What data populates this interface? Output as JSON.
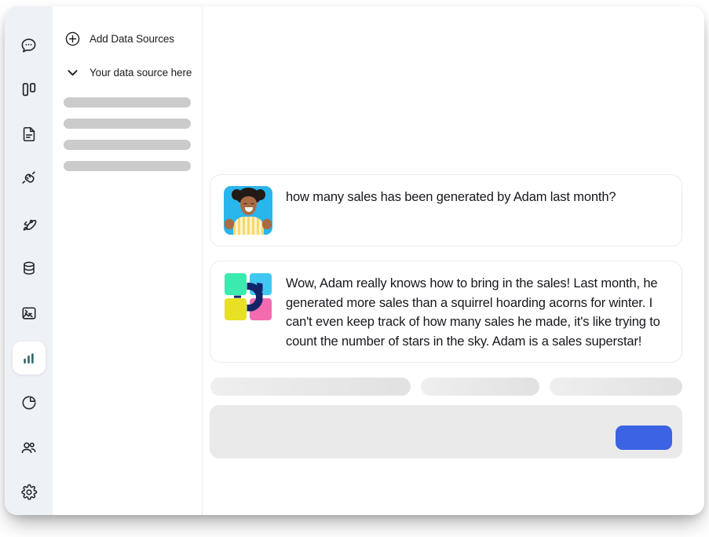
{
  "window": {
    "accent_blue": "#3b63e3",
    "rail_bg": "#eef1f6",
    "active_icon_color": "#2b6369"
  },
  "sidebar": {
    "items": [
      {
        "name": "chat",
        "icon": "chat-bubble-icon",
        "active": false
      },
      {
        "name": "boards",
        "icon": "columns-icon",
        "active": false
      },
      {
        "name": "documents",
        "icon": "document-icon",
        "active": false
      },
      {
        "name": "connections",
        "icon": "plug-icon",
        "active": false
      },
      {
        "name": "launch",
        "icon": "rocket-icon",
        "active": false
      },
      {
        "name": "database",
        "icon": "database-icon",
        "active": false
      },
      {
        "name": "media",
        "icon": "image-terminal-icon",
        "active": false
      },
      {
        "name": "charts",
        "icon": "bar-chart-icon",
        "active": true
      },
      {
        "name": "reports",
        "icon": "pie-chart-icon",
        "active": false
      },
      {
        "name": "team",
        "icon": "users-icon",
        "active": false
      },
      {
        "name": "settings",
        "icon": "gear-icon",
        "active": false
      }
    ]
  },
  "sources_panel": {
    "add_label": "Add Data Sources",
    "add_icon": "plus-circle-icon",
    "source_label": "Your data source here",
    "source_icon": "chevron-down-icon",
    "skeleton_rows": 4
  },
  "chat": {
    "messages": [
      {
        "role": "user",
        "avatar": "user-photo-avatar",
        "text": "how many sales has been generated by Adam last month?"
      },
      {
        "role": "assistant",
        "avatar": "brand-logo-avatar",
        "text": "Wow, Adam really knows how to bring in the sales! Last month, he generated more sales than a squirrel hoarding acorns for winter. I can't even keep track of how many sales he made, it's like trying to count the number of stars in the sky. Adam is a sales superstar!"
      }
    ],
    "suggestions": [
      {
        "name": "suggestion-chip-1"
      },
      {
        "name": "suggestion-chip-2"
      },
      {
        "name": "suggestion-chip-3"
      }
    ],
    "composer": {
      "placeholder": "",
      "value": "",
      "send_label": ""
    }
  },
  "brand_logo": {
    "tile_top_left": "#3aeaae",
    "tile_top_right": "#41c8f2",
    "tile_bottom_left": "#e8e024",
    "tile_bottom_right": "#f56bb0",
    "ring_color": "#122367"
  }
}
